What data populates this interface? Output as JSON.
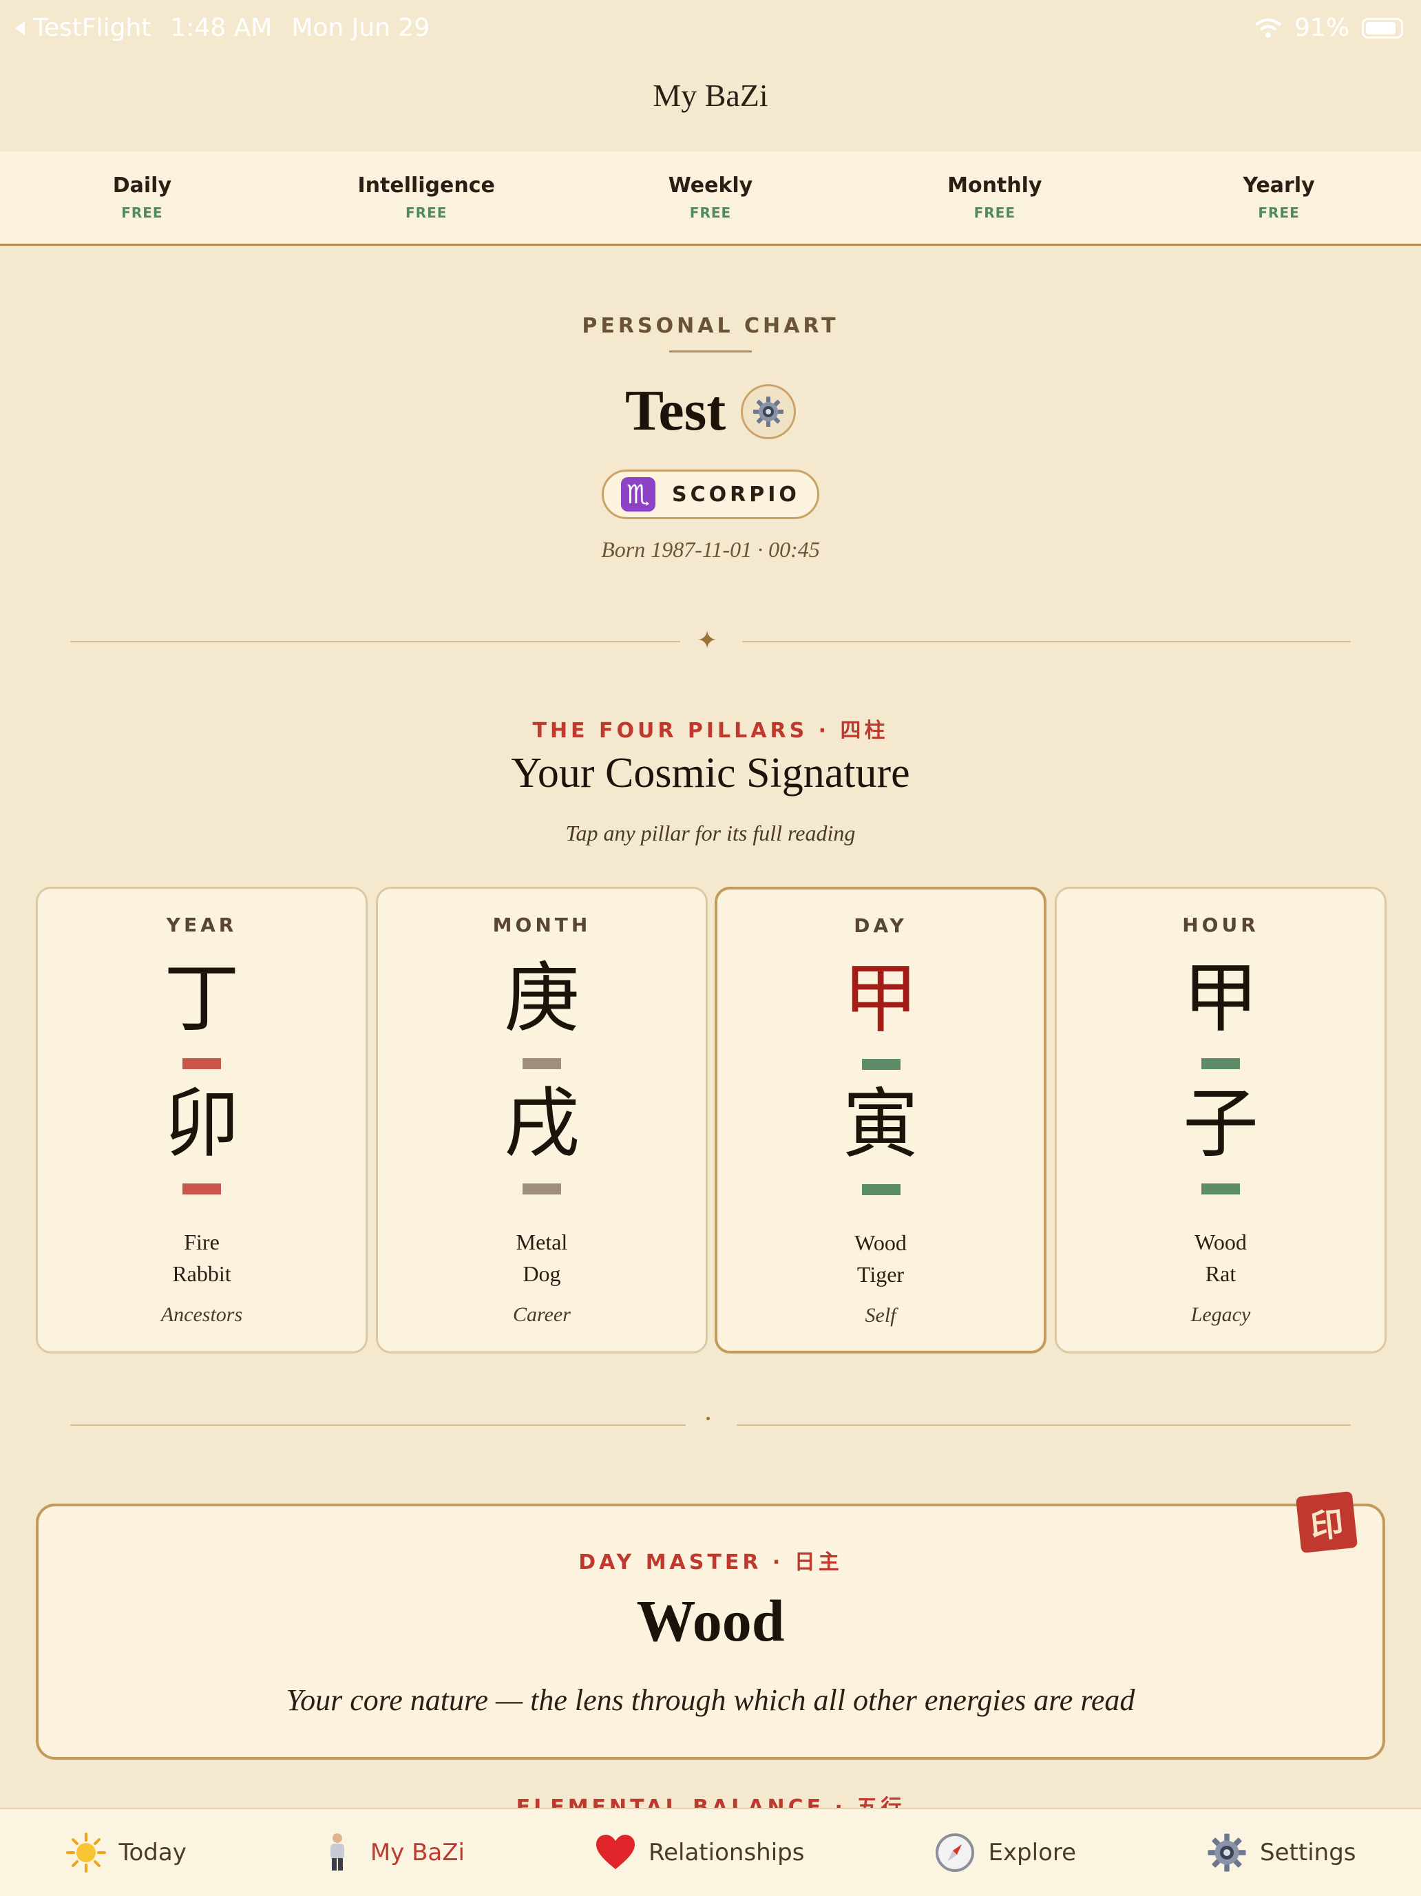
{
  "status_bar": {
    "back_app": "TestFlight",
    "time": "1:48 AM",
    "date": "Mon Jun 29",
    "battery": "91%"
  },
  "nav": {
    "title": "My BaZi"
  },
  "tabs": [
    {
      "label": "Daily",
      "tag": "FREE"
    },
    {
      "label": "Intelligence",
      "tag": "FREE"
    },
    {
      "label": "Weekly",
      "tag": "FREE"
    },
    {
      "label": "Monthly",
      "tag": "FREE"
    },
    {
      "label": "Yearly",
      "tag": "FREE"
    }
  ],
  "profile": {
    "section_label": "PERSONAL CHART",
    "name": "Test",
    "zodiac_symbol": "♏",
    "zodiac": "SCORPIO",
    "born": "Born 1987-11-01 · 00:45"
  },
  "four_pillars": {
    "label": "THE FOUR PILLARS · 四柱",
    "title": "Your Cosmic Signature",
    "subtitle": "Tap any pillar for its full reading",
    "pillars": [
      {
        "label": "YEAR",
        "stem": "丁",
        "branch": "卯",
        "element": "Fire",
        "animal": "Rabbit",
        "role": "Ancestors",
        "bar_color": "#c9544a"
      },
      {
        "label": "MONTH",
        "stem": "庚",
        "branch": "戌",
        "element": "Metal",
        "animal": "Dog",
        "role": "Career",
        "bar_color": "#a08f7a"
      },
      {
        "label": "DAY",
        "stem": "甲",
        "branch": "寅",
        "element": "Wood",
        "animal": "Tiger",
        "role": "Self",
        "bar_color": "#5e8c69"
      },
      {
        "label": "HOUR",
        "stem": "甲",
        "branch": "子",
        "element": "Wood",
        "animal": "Rat",
        "role": "Legacy",
        "bar_color": "#5e8c69"
      }
    ]
  },
  "day_master": {
    "label": "DAY MASTER · 日主",
    "value": "Wood",
    "description": "Your core nature — the lens through which all other energies are read",
    "seal": "印"
  },
  "elemental_balance": {
    "label": "ELEMENTAL BALANCE · 五行"
  },
  "tab_bar": [
    {
      "label": "Today",
      "icon": "sun-icon"
    },
    {
      "label": "My BaZi",
      "icon": "person-icon",
      "active": true
    },
    {
      "label": "Relationships",
      "icon": "heart-icon"
    },
    {
      "label": "Explore",
      "icon": "compass-icon"
    },
    {
      "label": "Settings",
      "icon": "gear-icon"
    }
  ],
  "colors": {
    "accent_red": "#c0392f",
    "free_green": "#4e8c60",
    "gold": "#c39a5c",
    "background": "#f4e9cf"
  }
}
